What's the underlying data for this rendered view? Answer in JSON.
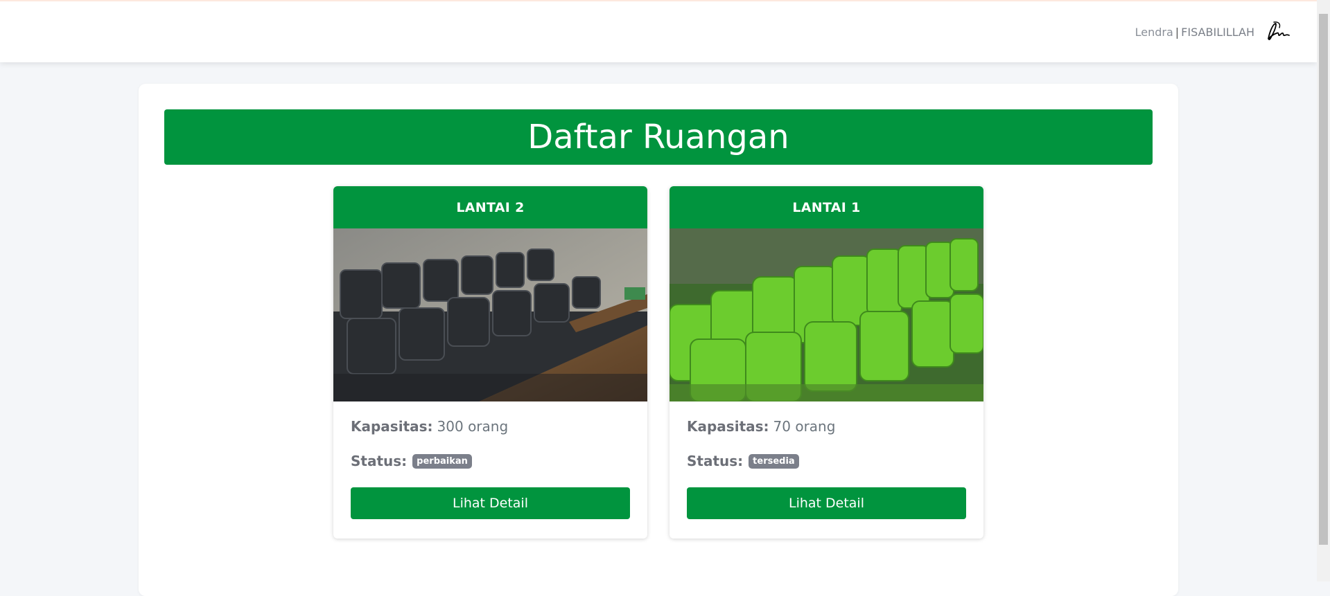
{
  "header": {
    "user_first": "Lendra",
    "user_separator": "|",
    "user_last": "FISABILILLAH"
  },
  "page": {
    "title": "Daftar Ruangan"
  },
  "rooms": [
    {
      "name": "LANTAI 2",
      "capacity_label": "Kapasitas:",
      "capacity_value": "300 orang",
      "status_label": "Status:",
      "status_value": "perbaikan",
      "button_label": "Lihat Detail"
    },
    {
      "name": "LANTAI 1",
      "capacity_label": "Kapasitas:",
      "capacity_value": "70 orang",
      "status_label": "Status:",
      "status_value": "tersedia",
      "button_label": "Lihat Detail"
    }
  ],
  "colors": {
    "primary_green": "#01943e",
    "badge_gray": "#7b7f8a"
  }
}
